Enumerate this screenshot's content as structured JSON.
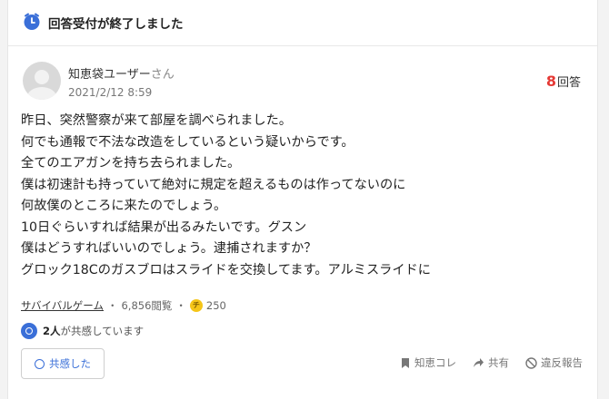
{
  "status": {
    "text": "回答受付が終了しました"
  },
  "author": {
    "name": "知恵袋ユーザー",
    "honorific": "さん",
    "date": "2021/2/12 8:59"
  },
  "answers": {
    "count": "8",
    "label": "回答"
  },
  "question": {
    "lines": [
      "昨日、突然警察が来て部屋を調べられました。",
      "何でも通報で不法な改造をしているという疑いからです。",
      "全てのエアガンを持ち去られました。",
      "僕は初速計も持っていて絶対に規定を超えるものは作ってないのに",
      "何故僕のところに来たのでしょう。",
      "10日ぐらいすれば結果が出るみたいです。グスン",
      "僕はどうすればいいのでしょう。逮捕されますか？",
      "グロック18Cのガスブロはスライドを交換してます。アルミスライドに"
    ]
  },
  "meta": {
    "category": "サバイバルゲーム",
    "sep1": "・",
    "views": "6,856閲覧",
    "sep2": "・",
    "coin_label": "チ",
    "coins": "250"
  },
  "empathy": {
    "count_text": "2人",
    "suffix": "が共感しています",
    "button_label": "共感した"
  },
  "actions": {
    "chiekore": "知恵コレ",
    "share": "共有",
    "report": "違反報告"
  },
  "colors": {
    "accent": "#3a6fd8",
    "answer_count": "#e53935",
    "coin": "#f5c518"
  },
  "icons": [
    "clock-icon",
    "avatar",
    "coin-icon",
    "empathy-icon",
    "bookmark-icon",
    "share-icon",
    "report-icon"
  ]
}
